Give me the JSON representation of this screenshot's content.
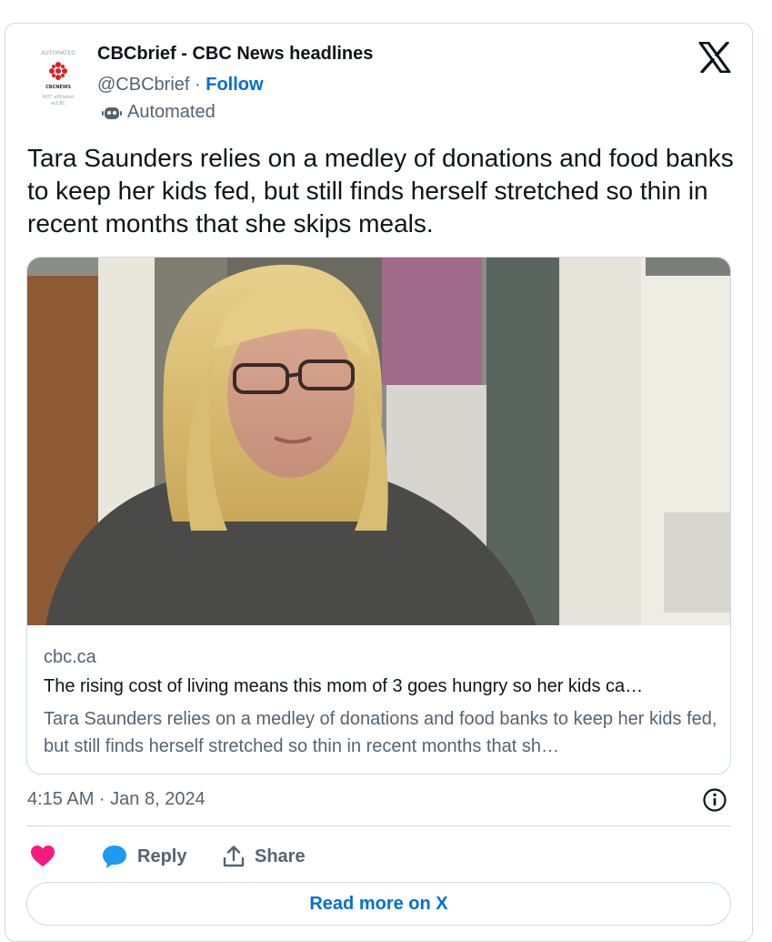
{
  "author": {
    "name": "CBCbrief - CBC News headlines",
    "handle": "@CBCbrief",
    "separator": "·",
    "follow_label": "Follow",
    "automated_label": "Automated",
    "avatar": {
      "top_text": "AUTOMATED",
      "logo_text": "CBCNEWS",
      "bottom_text_1": "NOT affiliated",
      "bottom_text_2": "w/CBC"
    }
  },
  "tweet": {
    "text": "Tara Saunders relies on a medley of donations and food banks to keep her kids fed, but still finds herself stretched so thin in recent months that she skips meals."
  },
  "link_card": {
    "domain": "cbc.ca",
    "title": "The rising cost of living means this mom of 3 goes hungry so her kids ca…",
    "description": "Tara Saunders relies on a medley of donations and food banks to keep her kids fed, but still finds herself stretched so thin in recent months that sh…"
  },
  "meta": {
    "timestamp": "4:15 AM · Jan 8, 2024"
  },
  "actions": {
    "reply_label": "Reply",
    "share_label": "Share",
    "read_more_label": "Read more on X"
  },
  "colors": {
    "accent_blue": "#006fd6",
    "like_pink": "#f91880",
    "reply_blue": "#1d9bf0",
    "secondary_text": "#536471",
    "border": "#cfd9de",
    "cbc_red": "#e31b23"
  }
}
